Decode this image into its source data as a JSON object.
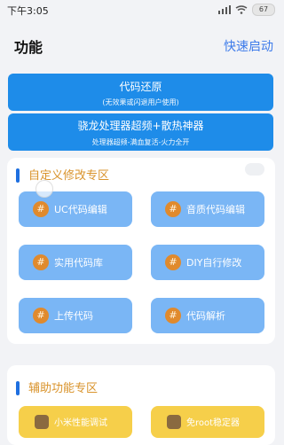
{
  "status_bar": {
    "time": "下午3:05",
    "battery": "67"
  },
  "header": {
    "title": "功能",
    "quick_start": "快速启动"
  },
  "buttons": [
    {
      "line1": "代码还原",
      "line2": "(无效果或闪退用户使用)"
    },
    {
      "line1": "骁龙处理器超频+散热神器",
      "line2": "处理器超频-满血复活-火力全开"
    }
  ],
  "custom_section": {
    "title": "自定义修改专区",
    "badge": "",
    "tiles": [
      {
        "label": "UC代码编辑"
      },
      {
        "label": "音质代码编辑"
      },
      {
        "label": "实用代码库"
      },
      {
        "label": "DIY自行修改"
      },
      {
        "label": "上传代码"
      },
      {
        "label": "代码解析"
      }
    ],
    "tile_icon_glyph": "#"
  },
  "aux_section": {
    "title": "辅助功能专区",
    "tiles": [
      {
        "label": "小米性能调试"
      },
      {
        "label": "免root稳定器"
      }
    ]
  },
  "colors": {
    "primary_blue": "#1e8ce9",
    "tile_blue": "#7ab6f5",
    "accent_orange": "#d9932b",
    "tile_yellow": "#f6cf4a"
  }
}
